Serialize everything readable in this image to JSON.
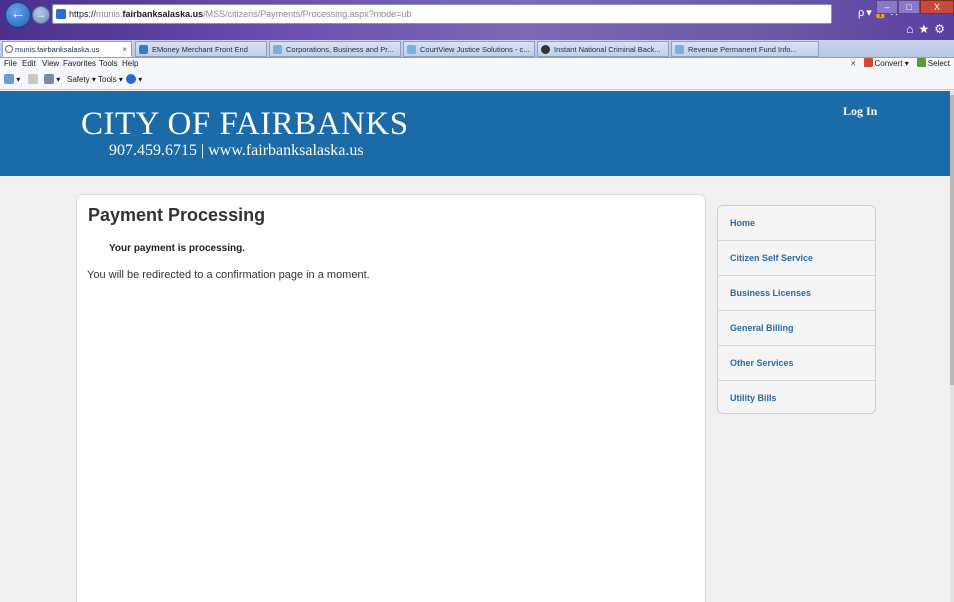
{
  "browser": {
    "address": {
      "scheme": "https://",
      "prefix": "munis.",
      "host": "fairbanksalaska.us",
      "path": "/MSS/citizens/Payments/Processing.aspx?mode=ub"
    },
    "address_tools": "ρ▾🔒✕",
    "tabs": [
      {
        "label": "munis.fairbanksalaska.us",
        "close": "×"
      },
      {
        "label": "EMoney Merchant Front End"
      },
      {
        "label": "Corporations, Business and Pr..."
      },
      {
        "label": "CourtView Justice Solutions - c..."
      },
      {
        "label": "Instant National Criminal Back..."
      },
      {
        "label": "Revenue Permanent Fund Info..."
      }
    ],
    "menu": [
      "File",
      "Edit",
      "View",
      "Favorites",
      "Tools",
      "Help"
    ],
    "menu_right": {
      "close": "×",
      "convert": "Convert",
      "select": "Select"
    },
    "commands": {
      "safety": "Safety ▾",
      "tools": "Tools ▾"
    },
    "window_buttons": {
      "min": "–",
      "max": "□",
      "close": "X"
    }
  },
  "site": {
    "title": "CITY OF FAIRBANKS",
    "subtitle": "907.459.6715 | www.fairbanksalaska.us",
    "login": "Log In"
  },
  "content": {
    "title": "Payment Processing",
    "message": "Your payment is processing.",
    "sub_message": "You will be redirected to a confirmation page in a moment."
  },
  "sidenav": {
    "items": [
      {
        "label": "Home"
      },
      {
        "label": "Citizen Self Service"
      },
      {
        "label": "Business Licenses"
      },
      {
        "label": "General Billing"
      },
      {
        "label": "Other Services"
      },
      {
        "label": "Utility Bills"
      }
    ]
  },
  "colors": {
    "header_blue": "#1b6ba8",
    "link_blue": "#2a6aa6"
  }
}
